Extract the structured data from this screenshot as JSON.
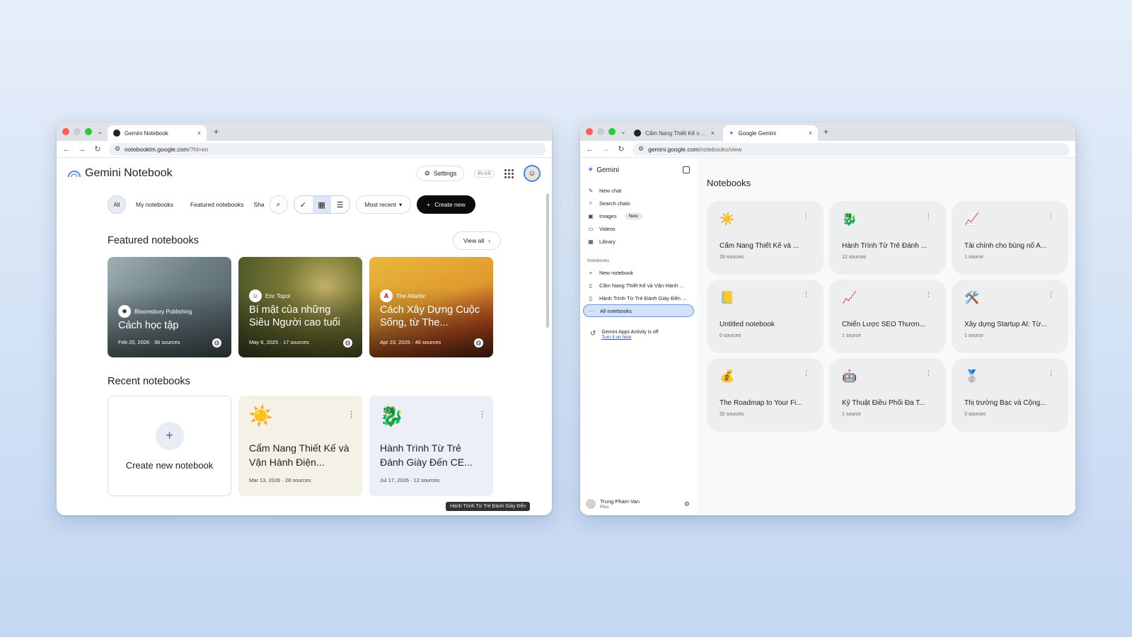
{
  "left_window": {
    "tab": {
      "title": "Gemini Notebook",
      "close": "×"
    },
    "new_tab": "+",
    "url": {
      "host": "notebooklm.google.com",
      "path": "/?hl=en"
    },
    "header": {
      "app_title": "Gemini Notebook",
      "settings_label": "Settings",
      "plan_badge": "PLUS"
    },
    "filters": {
      "all": "All",
      "my": "My notebooks",
      "featured": "Featured notebooks",
      "shared_cut": "Sha"
    },
    "sort_label": "Most recent",
    "create_label": "Create new",
    "featured": {
      "title": "Featured notebooks",
      "view_all": "View all",
      "cards": [
        {
          "source": "Bloomsbury Publishing",
          "source_logo": "✺",
          "title": "Cách học tập",
          "meta": "Feb 20, 2026 · 36 sources"
        },
        {
          "source": "Eric Topol",
          "source_logo": "☺",
          "title": "Bí mật của những Siêu Người cao tuổi",
          "meta": "May 6, 2025 · 17 sources"
        },
        {
          "source": "The Atlantic",
          "source_logo": "A",
          "title": "Cách Xây Dựng Cuộc Sống, từ The...",
          "meta": "Apr 23, 2025 · 46 sources"
        }
      ]
    },
    "recent": {
      "title": "Recent notebooks",
      "create_label": "Create new notebook",
      "cards": [
        {
          "emoji": "☀️",
          "title": "Cẩm Nang Thiết Kế và Vận Hành Điện...",
          "meta": "Mar 13, 2026 · 28 sources"
        },
        {
          "emoji": "🐉",
          "title": "Hành Trình Từ Trẻ Đánh Giày Đến CE...",
          "meta": "Jul 17, 2026 · 12 sources"
        }
      ]
    },
    "tooltip": "Hành Trình Từ Trẻ Đánh Giày Đến"
  },
  "right_window": {
    "tabs": [
      {
        "title": "Cẩm Nang Thiết Kế và Vận Hành",
        "close": "×"
      },
      {
        "title": "Google Gemini",
        "close": "×"
      }
    ],
    "new_tab": "+",
    "url": {
      "host": "gemini.google.com",
      "path": "/notebooks/view"
    },
    "sidebar": {
      "brand": "Gemini",
      "nav": [
        {
          "icon": "✎",
          "label": "New chat"
        },
        {
          "icon": "⌕",
          "label": "Search chats"
        },
        {
          "icon": "▣",
          "label": "Images",
          "badge": "New"
        },
        {
          "icon": "▭",
          "label": "Videos"
        },
        {
          "icon": "▦",
          "label": "Library"
        }
      ],
      "notebooks_heading": "Notebooks",
      "notebook_items": [
        {
          "icon": "+",
          "label": "New notebook"
        },
        {
          "icon": "▯",
          "label": "Cẩm Nang Thiết Kế và Vận Hành ..."
        },
        {
          "icon": "▯",
          "label": "Hành Trình Từ Trẻ Đánh Giày Đến ..."
        },
        {
          "icon": "···",
          "label": "All notebooks"
        }
      ],
      "activity": {
        "title": "Gemini Apps Activity is off",
        "link": "Turn it on here"
      },
      "user": {
        "name": "Trung Pham Van",
        "plan": "Plus"
      }
    },
    "main": {
      "title": "Notebooks",
      "cards": [
        {
          "emoji": "☀️",
          "title": "Cẩm Nang Thiết Kế và ...",
          "meta": "28 sources"
        },
        {
          "emoji": "🐉",
          "title": "Hành Trình Từ Trẻ Đánh ...",
          "meta": "12 sources"
        },
        {
          "emoji": "📈",
          "title": "Tài chính cho bùng nổ A...",
          "meta": "1 source"
        },
        {
          "emoji": "📒",
          "title": "Untitled notebook",
          "meta": "0 sources"
        },
        {
          "emoji": "📈",
          "title": "Chiến Lược SEO Thươn...",
          "meta": "1 source"
        },
        {
          "emoji": "🛠️",
          "title": "Xây dựng Startup AI: Từ...",
          "meta": "1 source"
        },
        {
          "emoji": "💰",
          "title": "The Roadmap to Your Fi...",
          "meta": "32 sources"
        },
        {
          "emoji": "🤖",
          "title": "Kỹ Thuật Điều Phối Đa T...",
          "meta": "1 source"
        },
        {
          "emoji": "🥈",
          "title": "Thị trường Bạc và Cộng...",
          "meta": "3 sources"
        }
      ]
    }
  },
  "colors": {
    "accent": "#4285f4",
    "create_button": "#0b0b0b",
    "active_nav": "#d3e2fb"
  }
}
